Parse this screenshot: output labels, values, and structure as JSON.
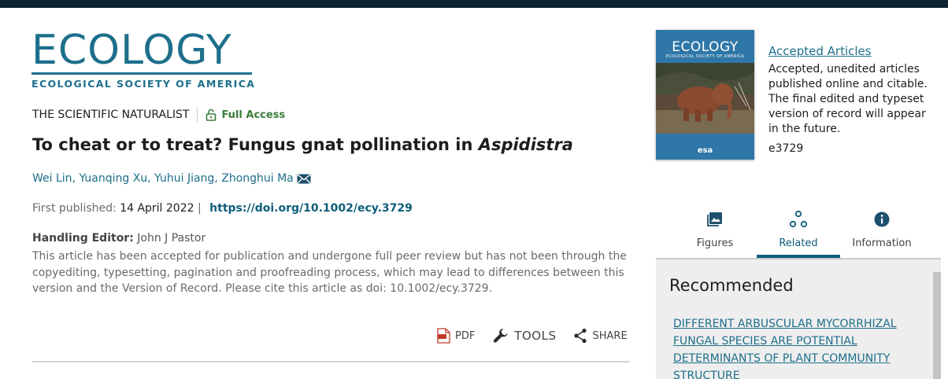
{
  "journal": {
    "name": "ECOLOGY",
    "society": "ECOLOGICAL SOCIETY OF AMERICA"
  },
  "article": {
    "section": "THE SCIENTIFIC NATURALIST",
    "access": "Full Access",
    "title_main": "To cheat or to treat? Fungus gnat pollination in ",
    "title_italic": "Aspidistra",
    "authors": "Wei Lin, Yuanqing Xu, Yuhui Jiang, Zhonghui Ma",
    "first_published_label": "First published:",
    "first_published_date": "14 April 2022",
    "separator": "|",
    "doi": "https://doi.org/10.1002/ecy.3729",
    "editor_label": "Handling Editor:",
    "editor_name": "John J Pastor",
    "notice": "This article has been accepted for publication and undergone full peer review but has not been through the copyediting, typesetting, pagination and proofreading process, which may lead to differences between this version and the Version of Record. Please cite this article as doi: 10.1002/ecy.3729."
  },
  "actions": {
    "pdf": "PDF",
    "tools": "TOOLS",
    "share": "SHARE"
  },
  "cover": {
    "title": "ECOLOGY",
    "subtitle": "ECOLOGICAL SOCIETY OF AMERICA",
    "publisher": "esa"
  },
  "accepted": {
    "title": "Accepted Articles",
    "description": "Accepted, unedited articles published online and citable. The final edited and typeset version of record will appear in the future.",
    "id": "e3729"
  },
  "tabs": [
    {
      "label": "Figures",
      "icon": "image-icon"
    },
    {
      "label": "Related",
      "icon": "related-icon"
    },
    {
      "label": "Information",
      "icon": "info-icon"
    }
  ],
  "recommended": {
    "heading": "Recommended",
    "link": "DIFFERENT ARBUSCULAR MYCORRHIZAL FUNGAL SPECIES ARE POTENTIAL DETERMINANTS OF PLANT COMMUNITY STRUCTURE"
  },
  "colors": {
    "brand": "#1d6f8b",
    "access_green": "#3a7d3a",
    "tab_active": "#0e5e7a",
    "topbar": "#0b2230"
  }
}
